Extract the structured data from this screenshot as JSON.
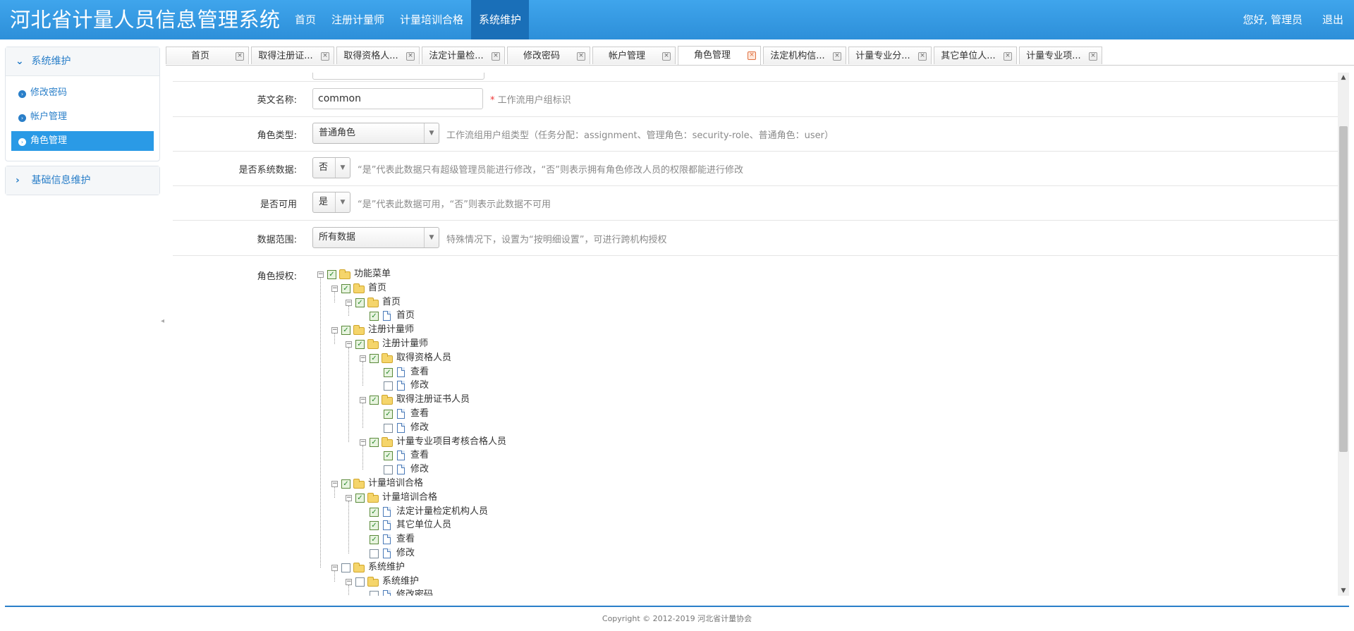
{
  "header": {
    "title": "河北省计量人员信息管理系统",
    "nav": [
      "首页",
      "注册计量师",
      "计量培训合格",
      "系统维护"
    ],
    "nav_active": 3,
    "greeting": "您好, 管理员",
    "logout": "退出"
  },
  "sidebar": {
    "panels": [
      {
        "title": "系统维护",
        "items": [
          "修改密码",
          "帐户管理",
          "角色管理"
        ],
        "active_item": 2
      },
      {
        "title": "基础信息维护"
      }
    ]
  },
  "tabs": [
    "首页",
    "取得注册证...",
    "取得资格人...",
    "法定计量检...",
    "修改密码",
    "帐户管理",
    "角色管理",
    "法定机构信...",
    "计量专业分...",
    "其它单位人...",
    "计量专业项..."
  ],
  "active_tab": 6,
  "form": {
    "english_name": {
      "label": "英文名称:",
      "value": "common",
      "required_mark": "*",
      "hint": "工作流用户组标识"
    },
    "role_type": {
      "label": "角色类型:",
      "value": "普通角色",
      "hint": "工作流组用户组类型（任务分配：assignment、管理角色：security-role、普通角色：user）"
    },
    "is_system": {
      "label": "是否系统数据:",
      "value": "否",
      "hint": "“是”代表此数据只有超级管理员能进行修改，“否”则表示拥有角色修改人员的权限都能进行修改"
    },
    "is_enabled": {
      "label": "是否可用",
      "value": "是",
      "hint": "“是”代表此数据可用，“否”则表示此数据不可用"
    },
    "data_scope": {
      "label": "数据范围:",
      "value": "所有数据",
      "hint": "特殊情况下，设置为“按明细设置”，可进行跨机构授权"
    },
    "role_auth": {
      "label": "角色授权:"
    }
  },
  "tree": [
    {
      "label": "功能菜单",
      "level": 0,
      "type": "folder",
      "checked": true,
      "expander": true
    },
    {
      "label": "首页",
      "level": 1,
      "type": "folder",
      "checked": true,
      "expander": true
    },
    {
      "label": "首页",
      "level": 2,
      "type": "folder",
      "checked": true,
      "expander": true
    },
    {
      "label": "首页",
      "level": 3,
      "type": "file",
      "checked": true,
      "expander": false
    },
    {
      "label": "注册计量师",
      "level": 1,
      "type": "folder",
      "checked": true,
      "expander": true
    },
    {
      "label": "注册计量师",
      "level": 2,
      "type": "folder",
      "checked": true,
      "expander": true
    },
    {
      "label": "取得资格人员",
      "level": 3,
      "type": "folder",
      "checked": true,
      "expander": true
    },
    {
      "label": "查看",
      "level": 4,
      "type": "file",
      "checked": true,
      "expander": false
    },
    {
      "label": "修改",
      "level": 4,
      "type": "file",
      "checked": false,
      "expander": false
    },
    {
      "label": "取得注册证书人员",
      "level": 3,
      "type": "folder",
      "checked": true,
      "expander": true
    },
    {
      "label": "查看",
      "level": 4,
      "type": "file",
      "checked": true,
      "expander": false
    },
    {
      "label": "修改",
      "level": 4,
      "type": "file",
      "checked": false,
      "expander": false
    },
    {
      "label": "计量专业项目考核合格人员",
      "level": 3,
      "type": "folder",
      "checked": true,
      "expander": true
    },
    {
      "label": "查看",
      "level": 4,
      "type": "file",
      "checked": true,
      "expander": false
    },
    {
      "label": "修改",
      "level": 4,
      "type": "file",
      "checked": false,
      "expander": false
    },
    {
      "label": "计量培训合格",
      "level": 1,
      "type": "folder",
      "checked": true,
      "expander": true
    },
    {
      "label": "计量培训合格",
      "level": 2,
      "type": "folder",
      "checked": true,
      "expander": true
    },
    {
      "label": "法定计量检定机构人员",
      "level": 3,
      "type": "file",
      "checked": true,
      "expander": false
    },
    {
      "label": "其它单位人员",
      "level": 3,
      "type": "file",
      "checked": true,
      "expander": false
    },
    {
      "label": "查看",
      "level": 3,
      "type": "file",
      "checked": true,
      "expander": false
    },
    {
      "label": "修改",
      "level": 3,
      "type": "file",
      "checked": false,
      "expander": false
    },
    {
      "label": "系统维护",
      "level": 1,
      "type": "folder",
      "checked": false,
      "expander": true
    },
    {
      "label": "系统维护",
      "level": 2,
      "type": "folder",
      "checked": false,
      "expander": true
    },
    {
      "label": "修改密码",
      "level": 3,
      "type": "file",
      "checked": false,
      "expander": false
    }
  ],
  "footer": {
    "copyright": "Copyright © 2012-2019 河北省计量协会"
  }
}
